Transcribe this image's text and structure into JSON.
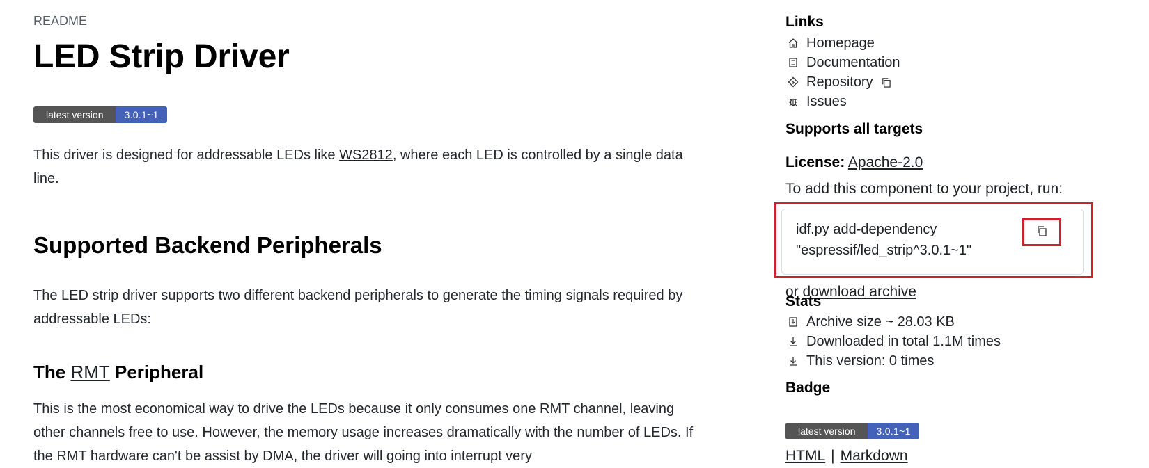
{
  "readme": {
    "label": "README",
    "title": "LED Strip Driver",
    "shield": {
      "label": "latest version",
      "value": "3.0.1~1"
    },
    "intro": {
      "before": "This driver is designed for addressable LEDs like ",
      "link": "WS2812",
      "after": ", where each LED is controlled by a single data line."
    },
    "section_title": "Supported Backend Peripherals",
    "section_text": "The LED strip driver supports two different backend peripherals to generate the timing signals required by addressable LEDs:",
    "subsection": {
      "before": "The ",
      "link": "RMT",
      "after": " Peripheral"
    },
    "subsection_text": "This is the most economical way to drive the LEDs because it only consumes one RMT channel, leaving other channels free to use. However, the memory usage increases dramatically with the number of LEDs. If the RMT hardware can't be assist by DMA, the driver will going into interrupt very"
  },
  "sidebar": {
    "links_title": "Links",
    "links": [
      {
        "label": "Homepage",
        "icon": "home-icon"
      },
      {
        "label": "Documentation",
        "icon": "book-icon"
      },
      {
        "label": "Repository",
        "icon": "git-icon"
      },
      {
        "label": "Issues",
        "icon": "bug-icon"
      }
    ],
    "targets": "Supports all targets",
    "license_label": "License:",
    "license_value": "Apache-2.0",
    "add_text": "To add this component to your project, run:",
    "command_line1": "idf.py add-dependency",
    "command_line2": "\"espressif/led_strip^3.0.1~1\"",
    "or_text": "or",
    "download_link": "download archive",
    "stats_title": "Stats",
    "stats": [
      {
        "label": "Archive size ~ 28.03 KB",
        "icon": "archive-icon"
      },
      {
        "label": "Downloaded in total 1.1M times",
        "icon": "download-icon"
      },
      {
        "label": "This version: 0 times",
        "icon": "download-icon"
      }
    ],
    "badge_title": "Badge",
    "badge_shield": {
      "label": "latest version",
      "value": "3.0.1~1"
    },
    "badge_formats": [
      "HTML",
      "|",
      "Markdown"
    ]
  }
}
